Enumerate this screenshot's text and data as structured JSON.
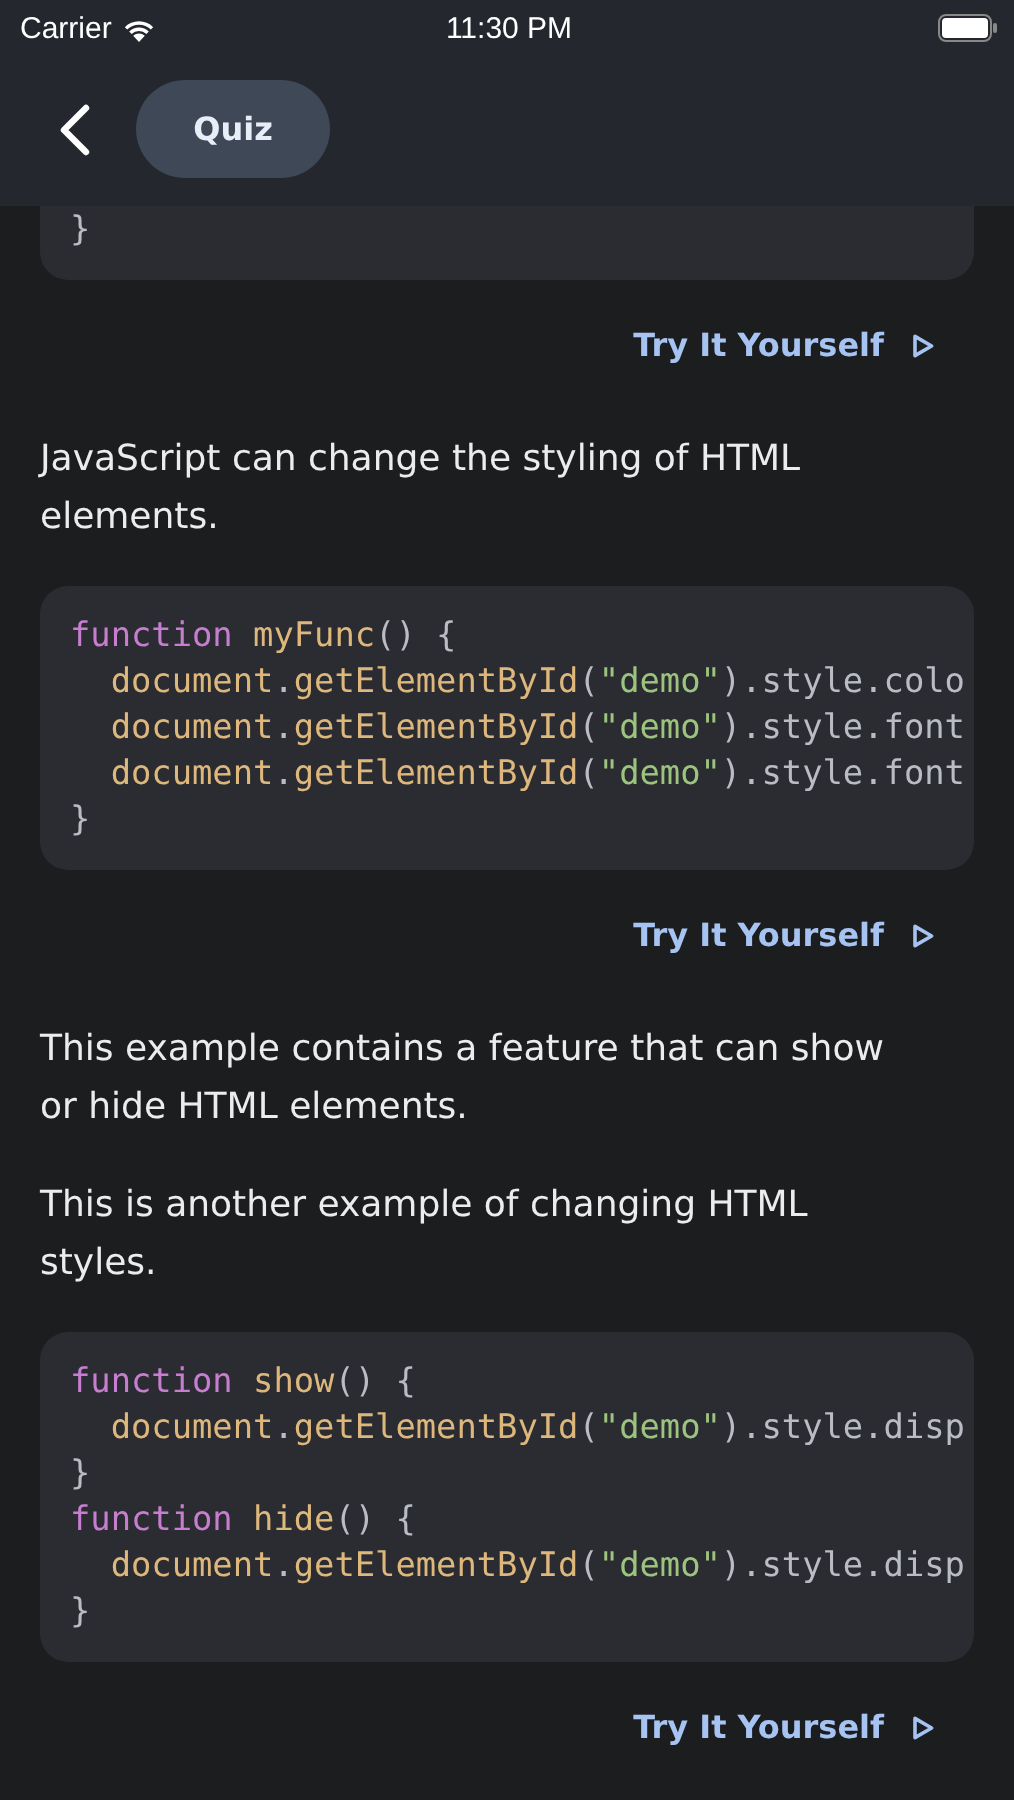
{
  "status_bar": {
    "carrier": "Carrier",
    "time": "11:30 PM"
  },
  "nav": {
    "tab": "Quiz"
  },
  "content": [
    {
      "kind": "code",
      "cut_top": true,
      "lines": [
        {
          "indent": false,
          "tokens": [
            {
              "kind": "punct",
              "text": "}"
            }
          ]
        }
      ]
    },
    {
      "kind": "link",
      "text": "Try It Yourself"
    },
    {
      "kind": "text",
      "text": "JavaScript can change the styling of HTML elements."
    },
    {
      "kind": "code",
      "cut_top": false,
      "lines": [
        {
          "indent": false,
          "tokens": [
            {
              "kind": "keyword",
              "text": "function"
            },
            {
              "kind": "name",
              "text": "myFunc"
            },
            {
              "kind": "punct",
              "text": "() {"
            }
          ]
        },
        {
          "indent": true,
          "tokens": [
            {
              "kind": "name",
              "text": "document"
            },
            {
              "kind": "punct",
              "text": "."
            },
            {
              "kind": "name",
              "text": "getElementById"
            },
            {
              "kind": "punct",
              "text": "("
            },
            {
              "kind": "string",
              "text": "\"demo\""
            },
            {
              "kind": "punct",
              "text": ").style.colo"
            }
          ]
        },
        {
          "indent": true,
          "tokens": [
            {
              "kind": "name",
              "text": "document"
            },
            {
              "kind": "punct",
              "text": "."
            },
            {
              "kind": "name",
              "text": "getElementById"
            },
            {
              "kind": "punct",
              "text": "("
            },
            {
              "kind": "string",
              "text": "\"demo\""
            },
            {
              "kind": "punct",
              "text": ").style.font"
            }
          ]
        },
        {
          "indent": true,
          "tokens": [
            {
              "kind": "name",
              "text": "document"
            },
            {
              "kind": "punct",
              "text": "."
            },
            {
              "kind": "name",
              "text": "getElementById"
            },
            {
              "kind": "punct",
              "text": "("
            },
            {
              "kind": "string",
              "text": "\"demo\""
            },
            {
              "kind": "punct",
              "text": ").style.font"
            }
          ]
        },
        {
          "indent": false,
          "tokens": [
            {
              "kind": "punct",
              "text": "}"
            }
          ]
        }
      ]
    },
    {
      "kind": "link",
      "text": "Try It Yourself"
    },
    {
      "kind": "text",
      "text": "This example contains a feature that can show or hide HTML elements."
    },
    {
      "kind": "text",
      "text": "This is another example of changing HTML styles."
    },
    {
      "kind": "code",
      "cut_top": false,
      "lines": [
        {
          "indent": false,
          "tokens": [
            {
              "kind": "keyword",
              "text": "function"
            },
            {
              "kind": "name",
              "text": "show"
            },
            {
              "kind": "punct",
              "text": "() {"
            }
          ]
        },
        {
          "indent": true,
          "tokens": [
            {
              "kind": "name",
              "text": "document"
            },
            {
              "kind": "punct",
              "text": "."
            },
            {
              "kind": "name",
              "text": "getElementById"
            },
            {
              "kind": "punct",
              "text": "("
            },
            {
              "kind": "string",
              "text": "\"demo\""
            },
            {
              "kind": "punct",
              "text": ").style.disp"
            }
          ]
        },
        {
          "indent": false,
          "tokens": [
            {
              "kind": "punct",
              "text": "}"
            }
          ]
        },
        {
          "indent": false,
          "tokens": [
            {
              "kind": "keyword",
              "text": "function"
            },
            {
              "kind": "name",
              "text": "hide"
            },
            {
              "kind": "punct",
              "text": "() {"
            }
          ]
        },
        {
          "indent": true,
          "tokens": [
            {
              "kind": "name",
              "text": "document"
            },
            {
              "kind": "punct",
              "text": "."
            },
            {
              "kind": "name",
              "text": "getElementById"
            },
            {
              "kind": "punct",
              "text": "("
            },
            {
              "kind": "string",
              "text": "\"demo\""
            },
            {
              "kind": "punct",
              "text": ").style.disp"
            }
          ]
        },
        {
          "indent": false,
          "tokens": [
            {
              "kind": "punct",
              "text": "}"
            }
          ]
        }
      ]
    },
    {
      "kind": "link",
      "text": "Try It Yourself"
    }
  ]
}
